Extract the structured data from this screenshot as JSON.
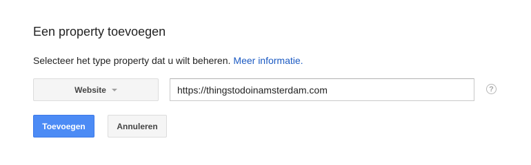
{
  "dialog": {
    "title": "Een property toevoegen",
    "description": "Selecteer het type property dat u wilt beheren.",
    "more_info_link": "Meer informatie."
  },
  "form": {
    "property_type": {
      "selected": "Website",
      "icon": "chevron-down-icon"
    },
    "url_input": {
      "value": "https://thingstodoinamsterdam.com"
    },
    "help": {
      "icon": "help-icon",
      "glyph": "?"
    }
  },
  "actions": {
    "add_label": "Toevoegen",
    "cancel_label": "Annuleren"
  },
  "colors": {
    "primary": "#4c8bf5",
    "link": "#1a59c2"
  }
}
